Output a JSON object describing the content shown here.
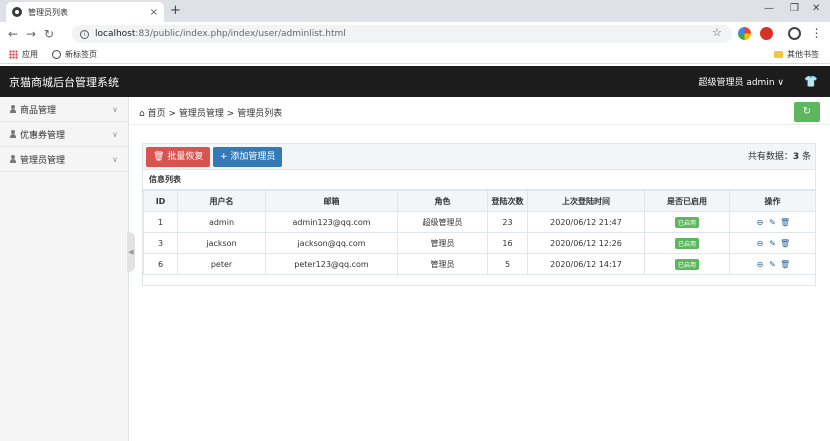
{
  "browser": {
    "tab_title": "管理员列表",
    "url_host": "localhost",
    "url_rest": ":83/public/index.php/index/user/adminlist.html",
    "bookmarks": [
      "应用",
      "新标签页"
    ],
    "other_bookmarks": "其他书签"
  },
  "header": {
    "brand": "京猫商城后台管理系统",
    "user": "超级管理员 admin"
  },
  "sidebar": {
    "items": [
      {
        "label": "商品管理"
      },
      {
        "label": "优惠券管理"
      },
      {
        "label": "管理员管理"
      }
    ]
  },
  "breadcrumb": {
    "home": "首页",
    "level1": "管理员管理",
    "level2": "管理员列表",
    "sep": ">"
  },
  "panel": {
    "batch_restore": "批量恢复",
    "add_admin": "添加管理员",
    "total_label": "共有数据：",
    "total_count": "3",
    "total_unit": "条",
    "title": "信息列表"
  },
  "table": {
    "headers": [
      "ID",
      "用户名",
      "邮箱",
      "角色",
      "登陆次数",
      "上次登陆时间",
      "是否已启用",
      "操作"
    ],
    "rows": [
      {
        "id": "1",
        "username": "admin",
        "email": "admin123@qq.com",
        "role": "超级管理员",
        "logins": "23",
        "last_login": "2020/06/12 21:47",
        "status": "已启用"
      },
      {
        "id": "3",
        "username": "jackson",
        "email": "jackson@qq.com",
        "role": "管理员",
        "logins": "16",
        "last_login": "2020/06/12 12:26",
        "status": "已启用"
      },
      {
        "id": "6",
        "username": "peter",
        "email": "peter123@qq.com",
        "role": "管理员",
        "logins": "5",
        "last_login": "2020/06/12 14:17",
        "status": "已启用"
      }
    ]
  },
  "colors": {
    "appbar": "#1c1c1c",
    "danger": "#d9534f",
    "primary": "#337ab7",
    "success": "#5cb85c"
  }
}
